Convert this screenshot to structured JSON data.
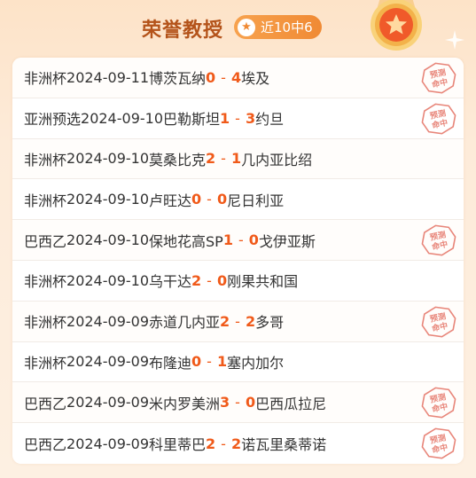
{
  "header": {
    "title": "荣誉教授",
    "badge_label": "近10中6"
  },
  "stamp_text": "预测命中",
  "colors": {
    "title": "#b4531a",
    "badge": "#f08a34",
    "score": "#f05a1a",
    "stamp": "#e8867a"
  },
  "matches": [
    {
      "league": "非洲杯",
      "date": "2024-09-11",
      "home": "博茨瓦纳",
      "home_score": "0",
      "sep": "-",
      "away_score": "4",
      "away": "埃及",
      "hit": true
    },
    {
      "league": "亚洲预选",
      "date": "2024-09-10",
      "home": "巴勒斯坦",
      "home_score": "1",
      "sep": "-",
      "away_score": "3",
      "away": "约旦",
      "hit": true
    },
    {
      "league": "非洲杯",
      "date": "2024-09-10",
      "home": "莫桑比克",
      "home_score": "2",
      "sep": "-",
      "away_score": "1",
      "away": "几内亚比绍",
      "hit": false
    },
    {
      "league": "非洲杯",
      "date": "2024-09-10",
      "home": "卢旺达",
      "home_score": "0",
      "sep": "-",
      "away_score": "0",
      "away": "尼日利亚",
      "hit": false
    },
    {
      "league": "巴西乙",
      "date": "2024-09-10",
      "home": "保地花高SP",
      "home_score": "1",
      "sep": "-",
      "away_score": "0",
      "away": "戈伊亚斯",
      "hit": true
    },
    {
      "league": "非洲杯",
      "date": "2024-09-10",
      "home": "乌干达",
      "home_score": "2",
      "sep": "-",
      "away_score": "0",
      "away": "刚果共和国",
      "hit": false
    },
    {
      "league": "非洲杯",
      "date": "2024-09-09",
      "home": "赤道几内亚",
      "home_score": "2",
      "sep": "-",
      "away_score": "2",
      "away": "多哥",
      "hit": true
    },
    {
      "league": "非洲杯",
      "date": "2024-09-09",
      "home": "布隆迪",
      "home_score": "0",
      "sep": "-",
      "away_score": "1",
      "away": "塞内加尔",
      "hit": false
    },
    {
      "league": "巴西乙",
      "date": "2024-09-09",
      "home": "米内罗美洲",
      "home_score": "3",
      "sep": "-",
      "away_score": "0",
      "away": "巴西瓜拉尼",
      "hit": true
    },
    {
      "league": "巴西乙",
      "date": "2024-09-09",
      "home": "科里蒂巴",
      "home_score": "2",
      "sep": "-",
      "away_score": "2",
      "away": "诺瓦里桑蒂诺",
      "hit": true
    }
  ]
}
